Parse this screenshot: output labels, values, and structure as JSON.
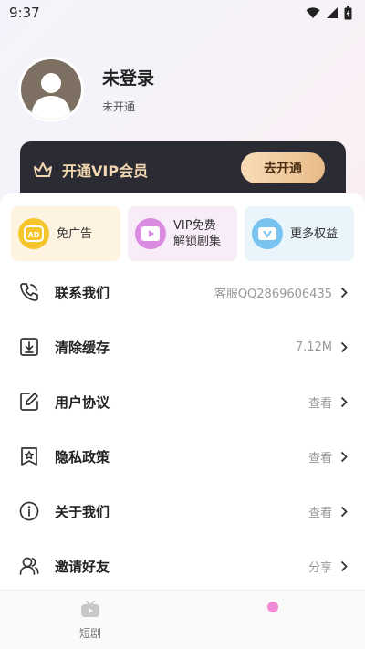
{
  "status_bar": {
    "time": "9:37"
  },
  "profile": {
    "username": "未登录",
    "vip_status": "未开通"
  },
  "vip_card": {
    "title": "开通VIP会员",
    "button_label": "去开通",
    "accent_color": "#f2d7b0"
  },
  "quick_actions": [
    {
      "label": "免广告",
      "icon": "ad-icon"
    },
    {
      "label": "VIP免费\n解锁剧集",
      "icon": "play-icon"
    },
    {
      "label": "更多权益",
      "icon": "v-icon"
    }
  ],
  "menu": [
    {
      "label": "联系我们",
      "value": "客服QQ2869606435",
      "icon": "phone-icon"
    },
    {
      "label": "清除缓存",
      "value": "7.12M",
      "icon": "clear-cache-icon"
    },
    {
      "label": "用户协议",
      "value": "查看",
      "icon": "edit-document-icon"
    },
    {
      "label": "隐私政策",
      "value": "查看",
      "icon": "privacy-star-icon"
    },
    {
      "label": "关于我们",
      "value": "查看",
      "icon": "info-icon"
    },
    {
      "label": "邀请好友",
      "value": "分享",
      "icon": "users-icon"
    }
  ],
  "tab_bar": {
    "tabs": [
      {
        "label": "短剧",
        "icon": "tv-icon"
      }
    ]
  }
}
